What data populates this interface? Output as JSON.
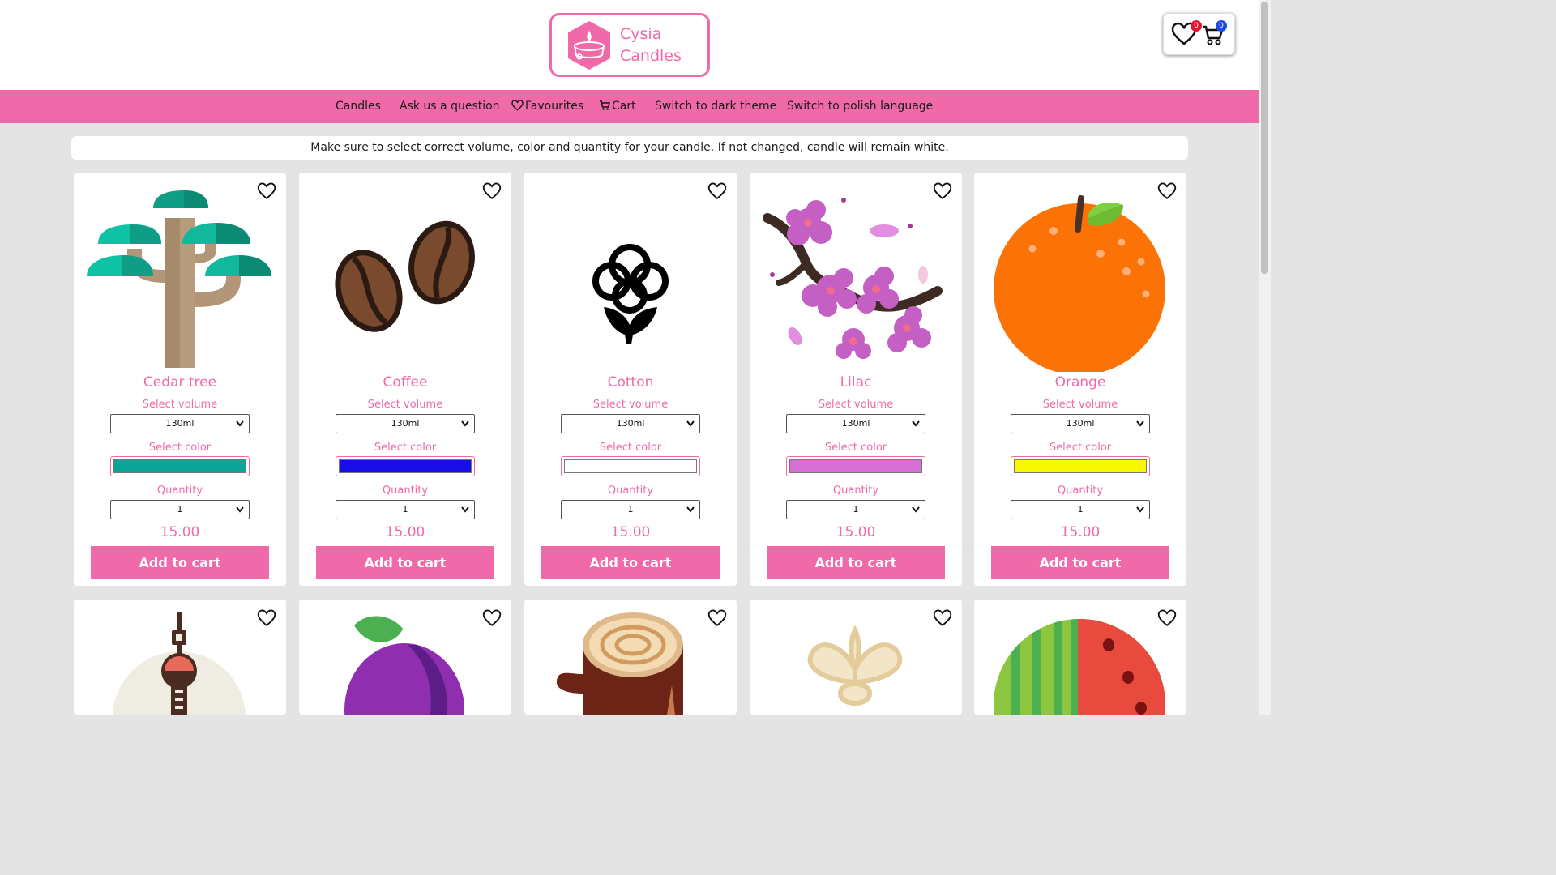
{
  "header": {
    "logo_line1": "Cysia",
    "logo_line2": "Candles",
    "favourites_count": "0",
    "cart_count": "0"
  },
  "nav": {
    "candles": "Candles",
    "ask": "Ask us a question",
    "favourites": "Favourites",
    "cart": "Cart",
    "dark_theme": "Switch to dark theme",
    "polish": "Switch to polish language"
  },
  "notice": "Make sure to select correct volume, color and quantity for your candle. If not changed, candle will remain white.",
  "labels": {
    "volume": "Select volume",
    "color": "Select color",
    "quantity": "Quantity",
    "add_to_cart": "Add to cart"
  },
  "products": [
    {
      "name": "Cedar tree",
      "icon": "cedar-tree-icon",
      "volume": "130ml",
      "color": "#0aa597",
      "quantity": "1",
      "price": "15.00"
    },
    {
      "name": "Coffee",
      "icon": "coffee-beans-icon",
      "volume": "130ml",
      "color": "#1a0ee8",
      "quantity": "1",
      "price": "15.00"
    },
    {
      "name": "Cotton",
      "icon": "cotton-icon",
      "volume": "130ml",
      "color": "#ffffff",
      "quantity": "1",
      "price": "15.00"
    },
    {
      "name": "Lilac",
      "icon": "lilac-icon",
      "volume": "130ml",
      "color": "#d66fd6",
      "quantity": "1",
      "price": "15.00"
    },
    {
      "name": "Orange",
      "icon": "orange-icon",
      "volume": "130ml",
      "color": "#f8f800",
      "quantity": "1",
      "price": "15.00"
    }
  ],
  "products_row2_icons": [
    "tv-tower-icon",
    "plum-icon",
    "wood-log-icon",
    "vanilla-flower-icon",
    "watermelon-icon"
  ],
  "colors": {
    "accent": "#f06aaa",
    "background": "#e4e4e4"
  }
}
